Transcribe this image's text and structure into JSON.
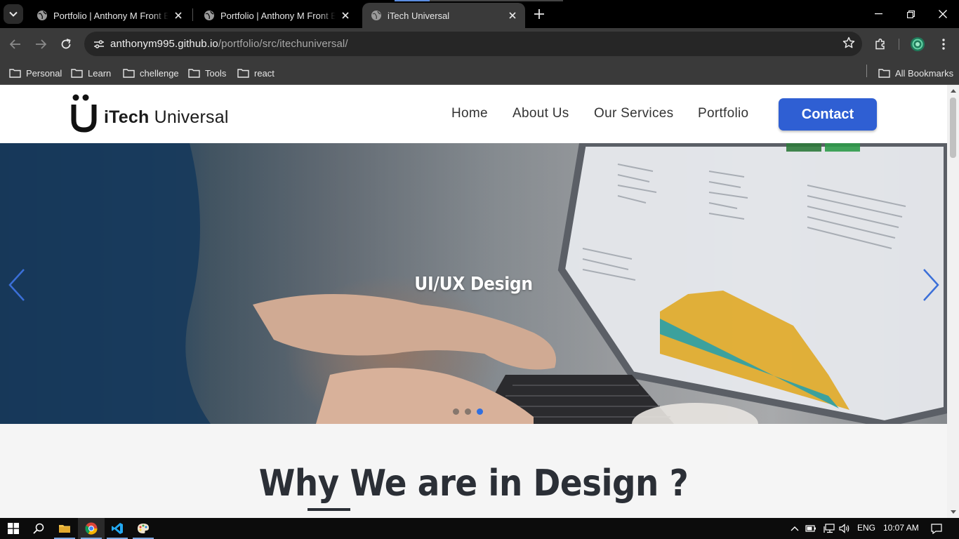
{
  "browser": {
    "tabs": [
      {
        "title": "Portfolio | Anthony M Front End",
        "active": false
      },
      {
        "title": "Portfolio | Anthony M Front End",
        "active": false
      },
      {
        "title": "iTech Universal",
        "active": true
      }
    ],
    "url": {
      "host": "anthonym995.github.io",
      "path": "/portfolio/src/itechuniversal/"
    },
    "bookmarks": [
      "Personal",
      "Learn",
      "chellenge",
      "Tools",
      "react"
    ],
    "all_bookmarks_label": "All Bookmarks"
  },
  "page": {
    "logo": {
      "bold": "iTech",
      "regular": " Universal"
    },
    "nav": [
      "Home",
      "About Us",
      "Our Services",
      "Portfolio"
    ],
    "contact_label": "Contact",
    "hero": {
      "caption": "UI/UX Design",
      "slide_count": 3,
      "active_slide": 3
    },
    "section_title": "Why We are in Design ?"
  },
  "taskbar": {
    "language": "ENG",
    "time": "10:07 AM"
  },
  "colors": {
    "accent": "#2f5fd3",
    "carousel_active_dot": "#2f6fe0",
    "heading": "#2b2f36"
  }
}
